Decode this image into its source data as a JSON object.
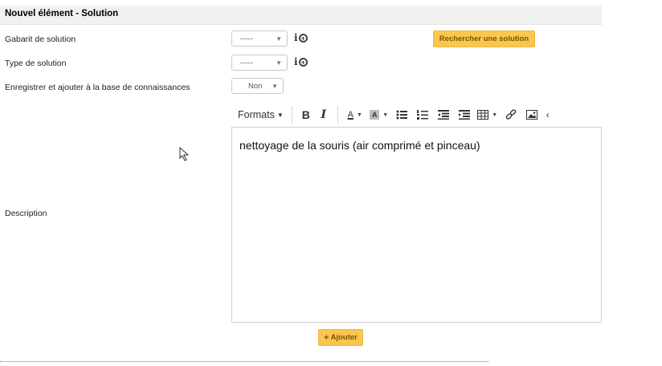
{
  "header": {
    "title": "Nouvel élément - Solution"
  },
  "form": {
    "template": {
      "label": "Gabarit de solution",
      "value": "-----"
    },
    "type": {
      "label": "Type de solution",
      "value": "-----"
    },
    "save_kb": {
      "label": "Enregistrer et ajouter à la base de connaissances",
      "value": "Non"
    },
    "search_button_label": "Rechercher une solution",
    "description_label": "Description"
  },
  "toolbar": {
    "formats_label": "Formats",
    "bold_label": "B",
    "italic_label": "I",
    "textcolor_label": "A",
    "bgcolor_label": "A"
  },
  "editor": {
    "content": "nettoyage de la souris (air comprimé et pinceau)"
  },
  "actions": {
    "add_label": "Ajouter"
  },
  "colors": {
    "accent": "#f9c74f",
    "header_bg": "#f1f1f1"
  }
}
